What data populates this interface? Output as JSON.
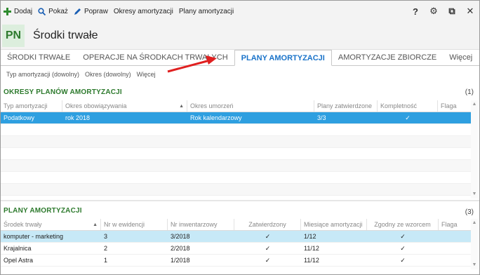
{
  "toolbar": {
    "add_label": "Dodaj",
    "show_label": "Pokaż",
    "edit_label": "Popraw",
    "periods_label": "Okresy amortyzacji",
    "plans_label": "Plany amortyzacji",
    "help_symbol": "?",
    "settings_symbol": "⚙",
    "restore_symbol": "⧉",
    "close_symbol": "✕"
  },
  "header": {
    "badge": "PN",
    "title": "Środki trwałe"
  },
  "tabs": [
    {
      "label": "ŚRODKI TRWAŁE"
    },
    {
      "label": "OPERACJE NA ŚRODKACH TRWAŁYCH"
    },
    {
      "label": "PLANY AMORTYZACJI",
      "active": true
    },
    {
      "label": "AMORTYZACJE ZBIORCZE"
    },
    {
      "label": "Więcej"
    }
  ],
  "filters": [
    "Typ amortyzacji (dowolny)",
    "Okres (dowolny)",
    "Więcej"
  ],
  "periods": {
    "title": "OKRESY PLANÓW AMORTYZACJI",
    "count": "(1)",
    "columns": [
      "Typ amortyzacji",
      "Okres obowiązywania",
      "Okres umorzeń",
      "Plany zatwierdzone",
      "Kompletność",
      "Flaga"
    ],
    "rows": [
      {
        "type": "Podatkowy",
        "period": "rok 2018",
        "amortization_period": "Rok kalendarzowy",
        "approved": "3/3",
        "complete": "✓",
        "flag": ""
      }
    ]
  },
  "plans": {
    "title": "PLANY AMORTYZACJI",
    "count": "(3)",
    "columns": [
      "Środek trwały",
      "Nr w ewidencji",
      "Nr inwentarzowy",
      "Zatwierdzony",
      "Miesiące amortyzacji",
      "Zgodny ze wzorcem",
      "Flaga"
    ],
    "rows": [
      {
        "asset": "komputer - marketing",
        "reg_no": "3",
        "inv_no": "3/2018",
        "approved": "✓",
        "months": "1/12",
        "pattern": "✓",
        "flag": ""
      },
      {
        "asset": "Krajalnica",
        "reg_no": "2",
        "inv_no": "2/2018",
        "approved": "✓",
        "months": "11/12",
        "pattern": "✓",
        "flag": ""
      },
      {
        "asset": "Opel Astra",
        "reg_no": "1",
        "inv_no": "1/2018",
        "approved": "✓",
        "months": "11/12",
        "pattern": "✓",
        "flag": ""
      }
    ]
  },
  "colors": {
    "accent_green": "#2d7a2d",
    "active_tab_blue": "#1a73c9",
    "selection_blue": "#2e9fe0",
    "selection_light": "#c7e9f7",
    "arrow_red": "#e02020"
  }
}
